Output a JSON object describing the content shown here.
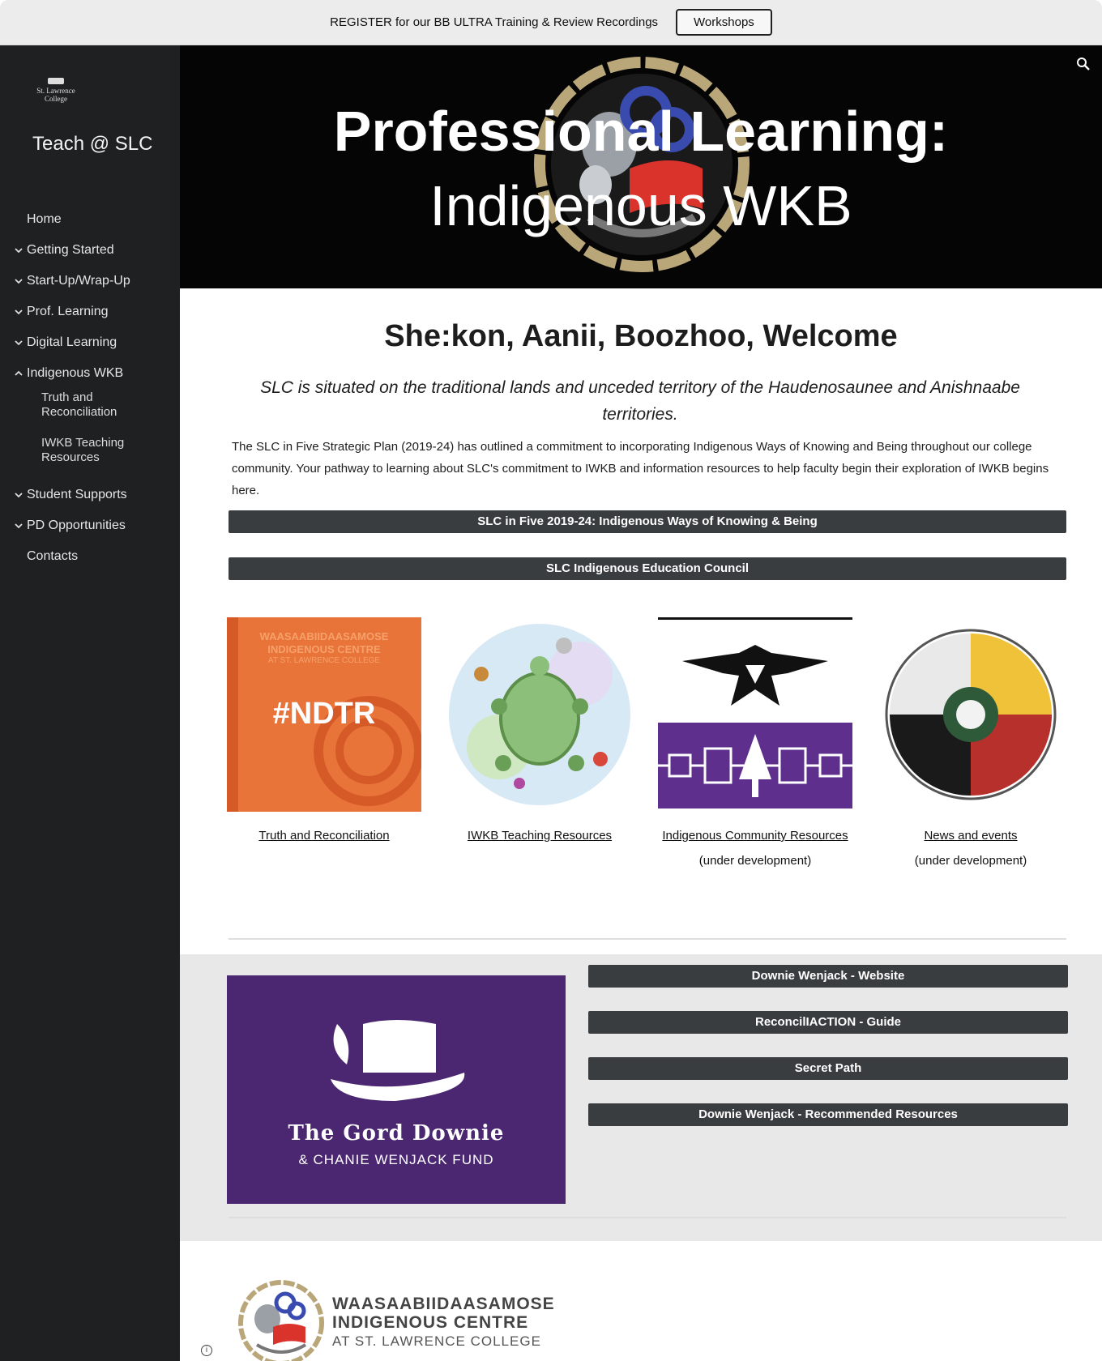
{
  "announcement": {
    "text": "REGISTER for our BB ULTRA Training & Review Recordings",
    "button_label": "Workshops"
  },
  "sidebar": {
    "logo_text_line1": "St. Lawrence",
    "logo_text_line2": "College",
    "site_title": "Teach @ SLC",
    "items": [
      {
        "label": "Home",
        "chevron": "none"
      },
      {
        "label": "Getting Started",
        "chevron": "down"
      },
      {
        "label": "Start-Up/Wrap-Up",
        "chevron": "down"
      },
      {
        "label": "Prof. Learning",
        "chevron": "down"
      },
      {
        "label": "Digital Learning",
        "chevron": "down"
      },
      {
        "label": "Indigenous WKB",
        "chevron": "up"
      }
    ],
    "subitems": [
      {
        "line1": "Truth and",
        "line2": "Reconciliation"
      },
      {
        "line1": "IWKB Teaching",
        "line2": "Resources"
      }
    ],
    "items_after": [
      {
        "label": "Student Supports",
        "chevron": "down"
      },
      {
        "label": "PD Opportunities",
        "chevron": "down"
      },
      {
        "label": "Contacts",
        "chevron": "none"
      }
    ]
  },
  "hero": {
    "title_line1": "Professional Learning:",
    "title_line2": "Indigenous WKB",
    "search_icon": "search-icon"
  },
  "main": {
    "welcome": "She:kon, Aanii, Boozhoo, Welcome",
    "intro": "SLC is situated on the traditional lands and unceded territory of the Haudenosaunee and Anishnaabe territories.",
    "paragraph": "The SLC in Five Strategic Plan (2019-24) has outlined a commitment to incorporating Indigenous Ways of Knowing and Being throughout our college community. Your pathway to learning about SLC's commitment to IWKB and information resources to help faculty begin their exploration of IWKB begins here.",
    "button1": "SLC in Five 2019-24: Indigenous Ways of Knowing & Being",
    "button2": "SLC Indigenous Education Council"
  },
  "cards": [
    {
      "link": "Truth and Reconciliation",
      "note": "",
      "img_text1": "WAASAABIIDAASAMOSE",
      "img_text2": "INDIGENOUS CENTRE",
      "img_text3": "AT ST. LAWRENCE COLLEGE",
      "img_text4": "#NDTR"
    },
    {
      "link": "IWKB Teaching Resources",
      "note": ""
    },
    {
      "link": "Indigenous Community Resources",
      "note": "(under development)"
    },
    {
      "link": "News and events",
      "note": "(under development)"
    }
  ],
  "downie": {
    "title": "The Gord Downie",
    "subtitle": "& CHANIE WENJACK FUND",
    "buttons": [
      "Downie Wenjack - Website",
      "ReconcilIACTION - Guide",
      "Secret Path",
      "Downie Wenjack - Recommended Resources"
    ]
  },
  "footer": {
    "line1": "WAASAABIIDAASAMOSE",
    "line2": "INDIGENOUS CENTRE",
    "line3": "AT ST. LAWRENCE COLLEGE"
  },
  "colors": {
    "sidebar_bg": "#1f2021",
    "button_bg": "#3a3d40",
    "downie_purple": "#4a2770",
    "ndtr_orange": "#e8743a",
    "haudenosaunee_purple": "#5e2f8c"
  }
}
